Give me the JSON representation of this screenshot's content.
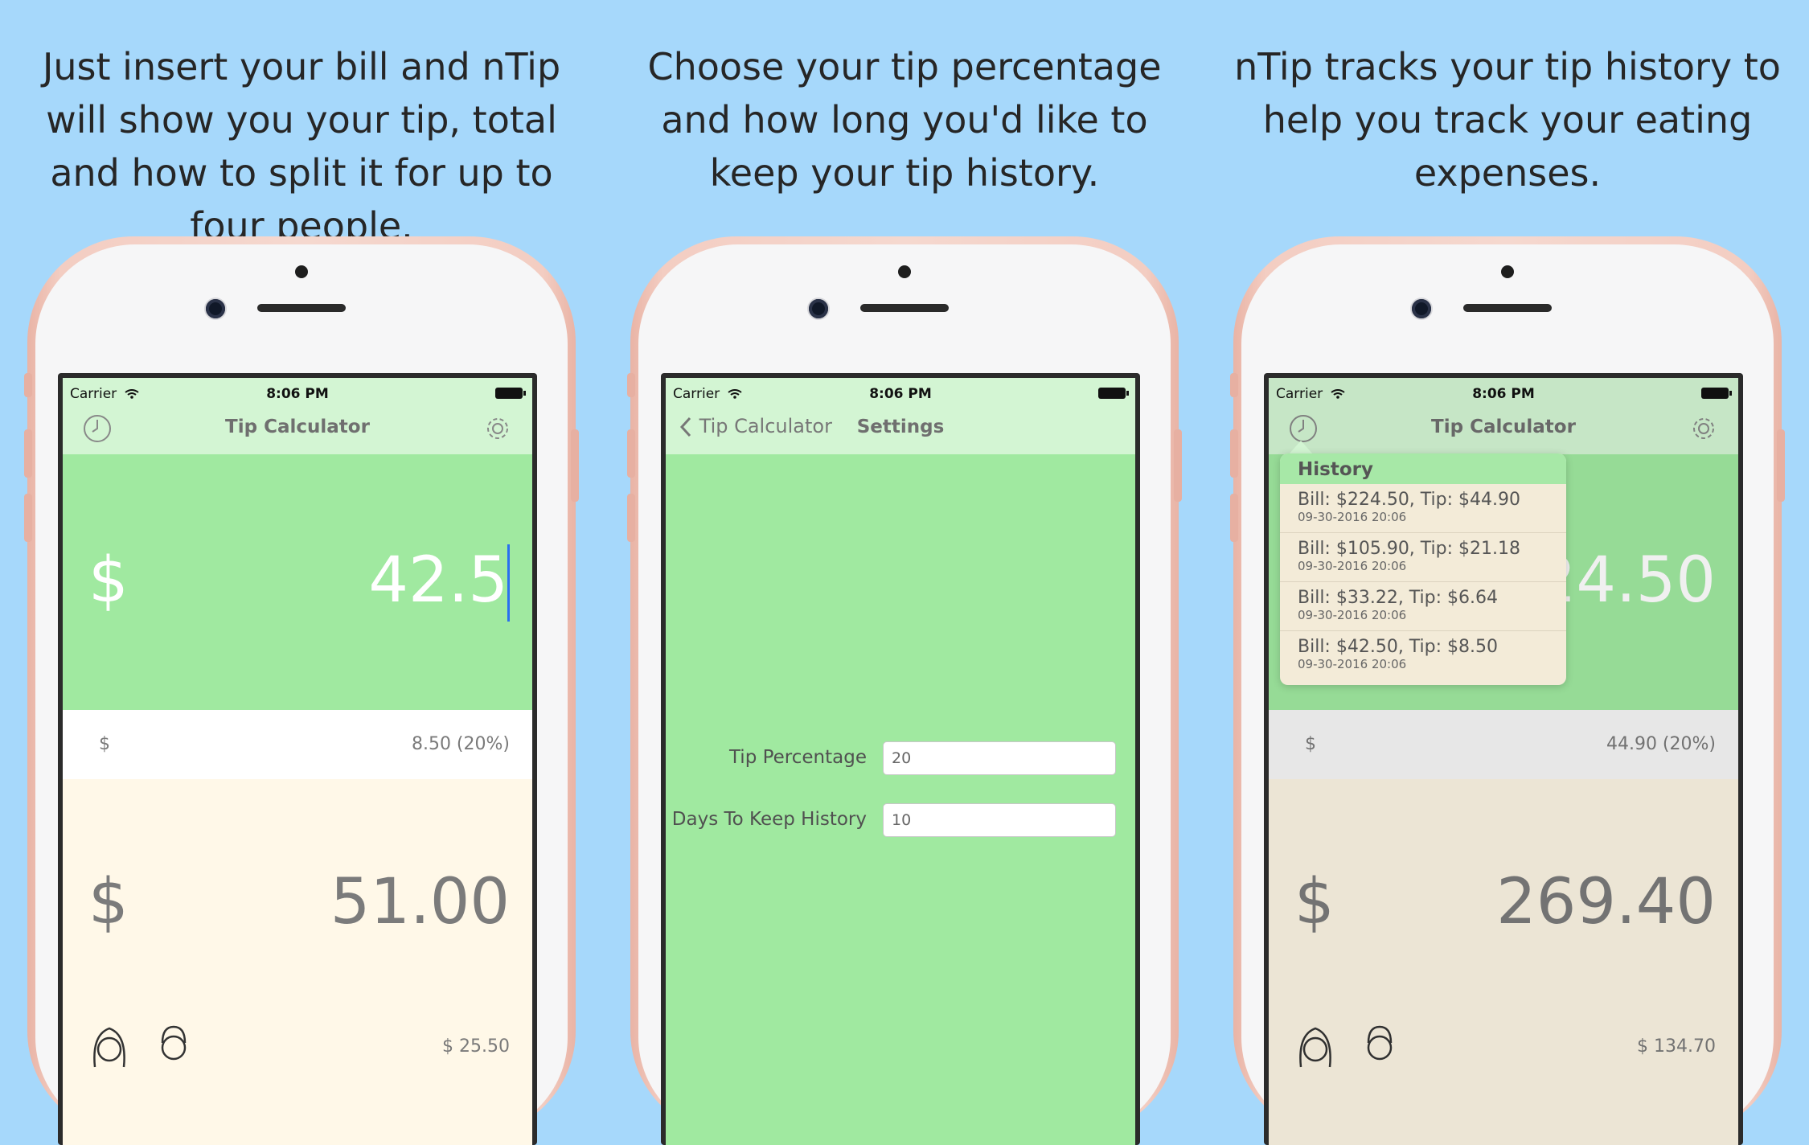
{
  "captions": [
    "Just insert your bill and nTip will show you your tip, total and how to split it for up to four people.",
    "Choose your tip percentage and how long you'd like to keep your tip history.",
    "nTip tracks your tip history to help you track your eating expenses."
  ],
  "status": {
    "carrier": "Carrier",
    "time": "8:06 PM"
  },
  "app_title": "Tip Calculator",
  "screen1": {
    "currency": "$",
    "bill": "42.5",
    "tip_currency": "$",
    "tip": "8.50  (20%)",
    "total": "51.00",
    "split": "$  25.50"
  },
  "screen2": {
    "back_label": "Tip Calculator",
    "title": "Settings",
    "tip_percentage_label": "Tip Percentage",
    "tip_percentage_value": "20",
    "days_label": "Days To Keep History",
    "days_value": "10"
  },
  "screen3": {
    "bill_partial": "24.50",
    "tip": "44.90  (20%)",
    "total": "269.40",
    "split": "$  134.70",
    "history_title": "History",
    "history": [
      {
        "entry": "Bill: $224.50, Tip: $44.90",
        "date": "09-30-2016 20:06"
      },
      {
        "entry": "Bill: $105.90, Tip: $21.18",
        "date": "09-30-2016 20:06"
      },
      {
        "entry": "Bill: $33.22, Tip: $6.64",
        "date": "09-30-2016 20:06"
      },
      {
        "entry": "Bill: $42.50, Tip: $8.50",
        "date": "09-30-2016 20:06"
      }
    ]
  },
  "icons": [
    "clock-icon",
    "gear-icon",
    "wifi-icon",
    "battery-icon",
    "back-chevron-icon",
    "woman-icon",
    "man-icon"
  ]
}
